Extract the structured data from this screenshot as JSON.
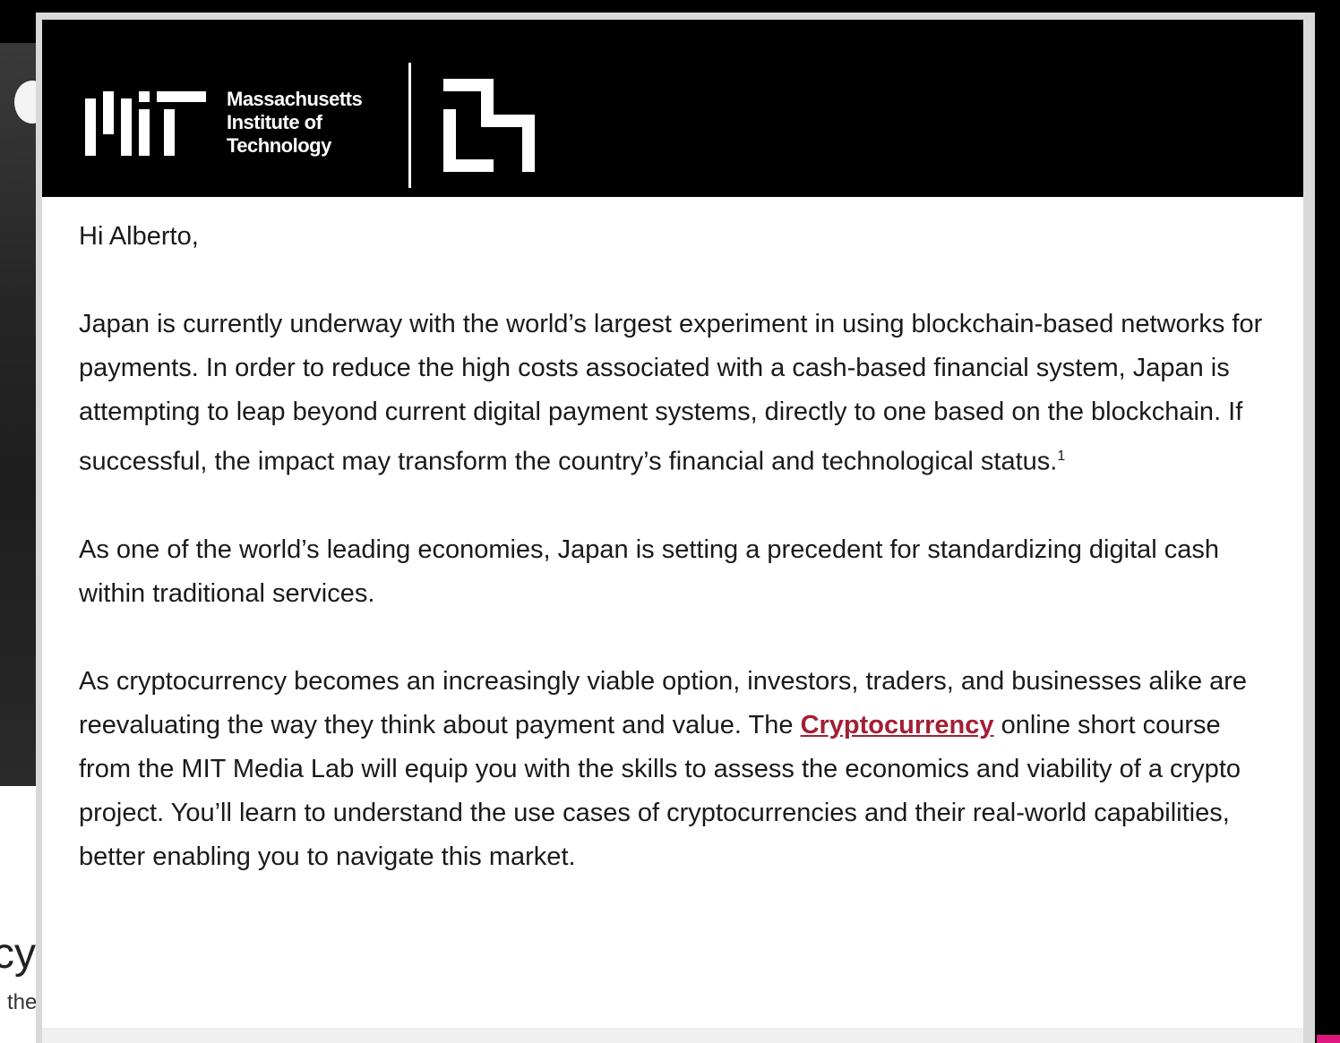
{
  "background": {
    "heading_fragment": "cy",
    "sub_fragment": "the"
  },
  "header": {
    "logo_lines": [
      "Massachusetts",
      "Institute of",
      "Technology"
    ]
  },
  "email": {
    "greeting": "Hi Alberto,",
    "paragraph_1": "Japan is currently underway with the world’s largest experiment in using blockchain-based networks for payments. In order to reduce the high costs associated with a cash-based financial system, Japan is attempting to leap beyond current digital payment systems, directly to one based on the blockchain. If successful, the impact may transform the country’s financial and technological status.",
    "paragraph_1_footnote": "1",
    "paragraph_2": "As one of the world’s leading economies, Japan is setting a precedent for standardizing digital cash within traditional services.",
    "paragraph_3_before_link": "As cryptocurrency becomes an increasingly viable option, investors, traders, and businesses alike are reevaluating the way they think about payment and value. The",
    "paragraph_3_link": "Cryptocurrency",
    "paragraph_3_after_link": " online short course from the MIT Media Lab will equip you with the skills to assess the economics and viability of a crypto project. You’ll learn to understand the use cases of cryptocurrencies and their real-world capabilities, better enabling you to navigate this market."
  },
  "colors": {
    "link": "#a31f34",
    "banner": "#000000",
    "accent": "#e0167f"
  },
  "icons": [
    "mit-logo-icon",
    "media-lab-logo-icon"
  ]
}
